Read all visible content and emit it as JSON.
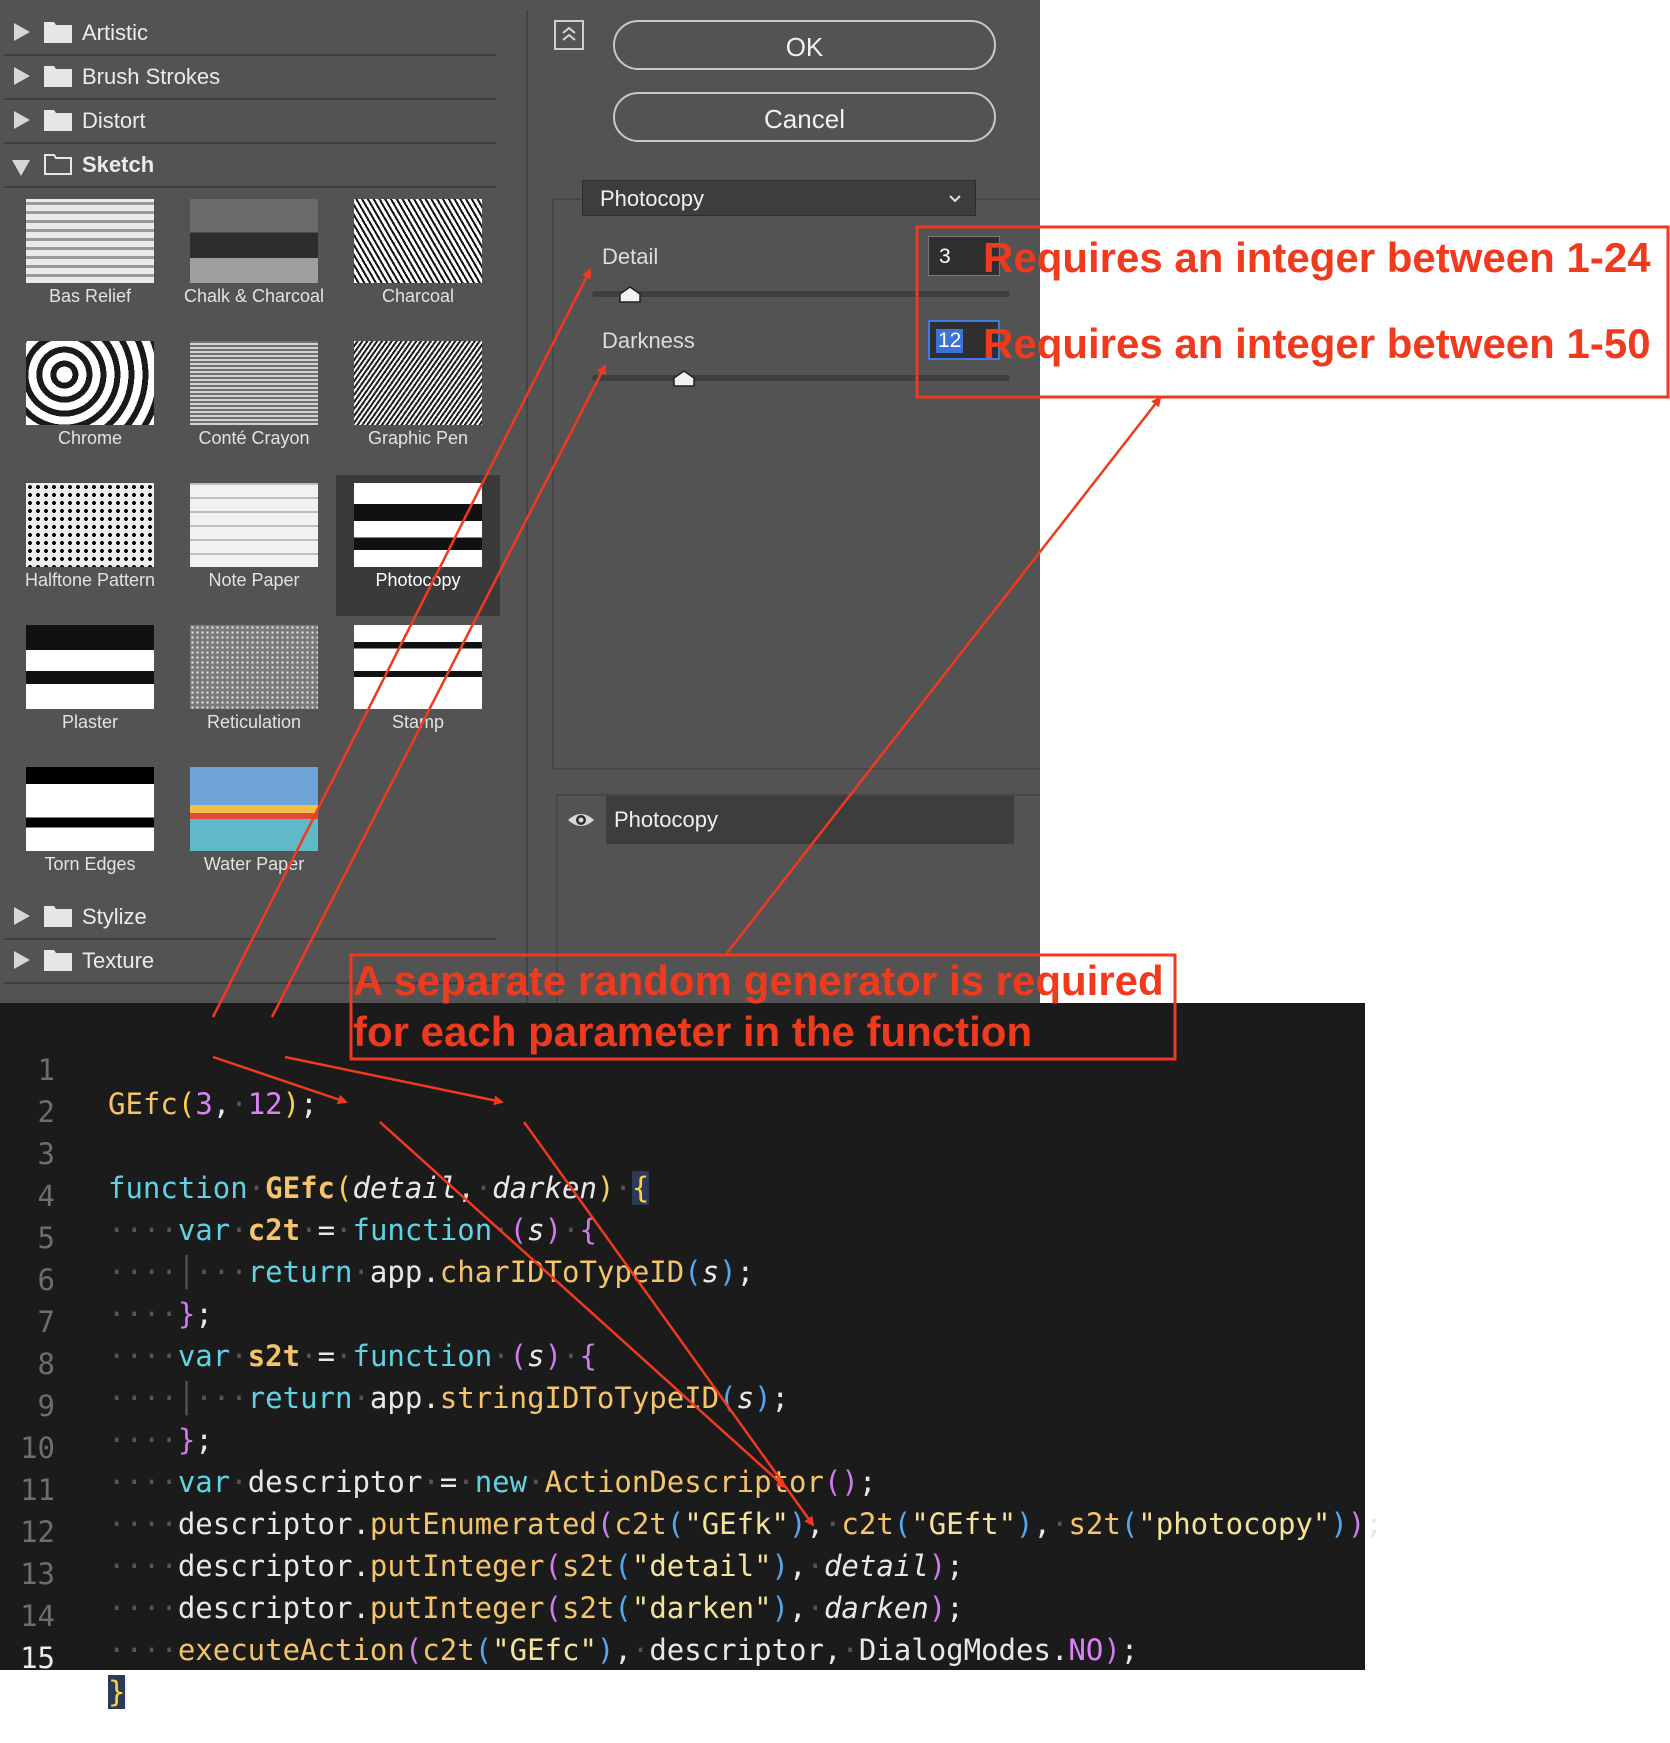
{
  "filter_gallery": {
    "categories_top": [
      {
        "label": "Artistic",
        "expanded": false
      },
      {
        "label": "Brush Strokes",
        "expanded": false
      },
      {
        "label": "Distort",
        "expanded": false
      },
      {
        "label": "Sketch",
        "expanded": true
      }
    ],
    "thumbnails": [
      {
        "label": "Bas Relief",
        "selected": false
      },
      {
        "label": "Chalk & Charcoal",
        "selected": false
      },
      {
        "label": "Charcoal",
        "selected": false
      },
      {
        "label": "Chrome",
        "selected": false
      },
      {
        "label": "Conté Crayon",
        "selected": false
      },
      {
        "label": "Graphic Pen",
        "selected": false
      },
      {
        "label": "Halftone Pattern",
        "selected": false
      },
      {
        "label": "Note Paper",
        "selected": false
      },
      {
        "label": "Photocopy",
        "selected": true
      },
      {
        "label": "Plaster",
        "selected": false
      },
      {
        "label": "Reticulation",
        "selected": false
      },
      {
        "label": "Stamp",
        "selected": false
      },
      {
        "label": "Torn Edges",
        "selected": false
      },
      {
        "label": "Water Paper",
        "selected": false
      }
    ],
    "categories_bottom": [
      {
        "label": "Stylize",
        "expanded": false
      },
      {
        "label": "Texture",
        "expanded": false
      }
    ]
  },
  "dialog": {
    "ok_label": "OK",
    "cancel_label": "Cancel",
    "filter_select": "Photocopy",
    "params": [
      {
        "label": "Detail",
        "value": "3",
        "fraction": 0.09
      },
      {
        "label": "Darkness",
        "value": "12",
        "fraction": 0.22
      }
    ],
    "layer_name": "Photocopy"
  },
  "annotations": {
    "range_detail": "Requires an integer between 1-24",
    "range_darkness": "Requires an integer between 1-50",
    "random_line1": "A separate random generator is required",
    "random_line2": "for each parameter in the function",
    "color": "#f03a1e"
  },
  "code": {
    "line_numbers": [
      "1",
      "2",
      "3",
      "4",
      "5",
      "6",
      "7",
      "8",
      "9",
      "10",
      "11",
      "12",
      "13",
      "14",
      "15"
    ],
    "l1": {
      "fn": "GEfc",
      "a1": "3",
      "a2": "12"
    },
    "l3": {
      "kw": "function",
      "fn": "GEfc",
      "p1": "detail",
      "p2": "darken"
    },
    "l4": {
      "kw": "var",
      "name": "c2t",
      "kw2": "function",
      "p": "s"
    },
    "l5": {
      "kw": "return",
      "obj": "app",
      "mt": "charIDToTypeID",
      "p": "s"
    },
    "l7": {
      "kw": "var",
      "name": "s2t",
      "kw2": "function",
      "p": "s"
    },
    "l8": {
      "kw": "return",
      "obj": "app",
      "mt": "stringIDToTypeID",
      "p": "s"
    },
    "l10": {
      "kw": "var",
      "name": "descriptor",
      "kw2": "new",
      "fn": "ActionDescriptor"
    },
    "l11": {
      "obj": "descriptor",
      "mt": "putEnumerated",
      "f1": "c2t",
      "s1": "\"GEfk\"",
      "f2": "c2t",
      "s2": "\"GEft\"",
      "f3": "s2t",
      "s3": "\"photocopy\""
    },
    "l12": {
      "obj": "descriptor",
      "mt": "putInteger",
      "f1": "s2t",
      "s1": "\"detail\"",
      "p": "detail"
    },
    "l13": {
      "obj": "descriptor",
      "mt": "putInteger",
      "f1": "s2t",
      "s1": "\"darken\"",
      "p": "darken"
    },
    "l14": {
      "mt": "executeAction",
      "f1": "c2t",
      "s1": "\"GEfc\"",
      "a": "descriptor",
      "obj": "DialogModes",
      "c": "NO"
    }
  }
}
